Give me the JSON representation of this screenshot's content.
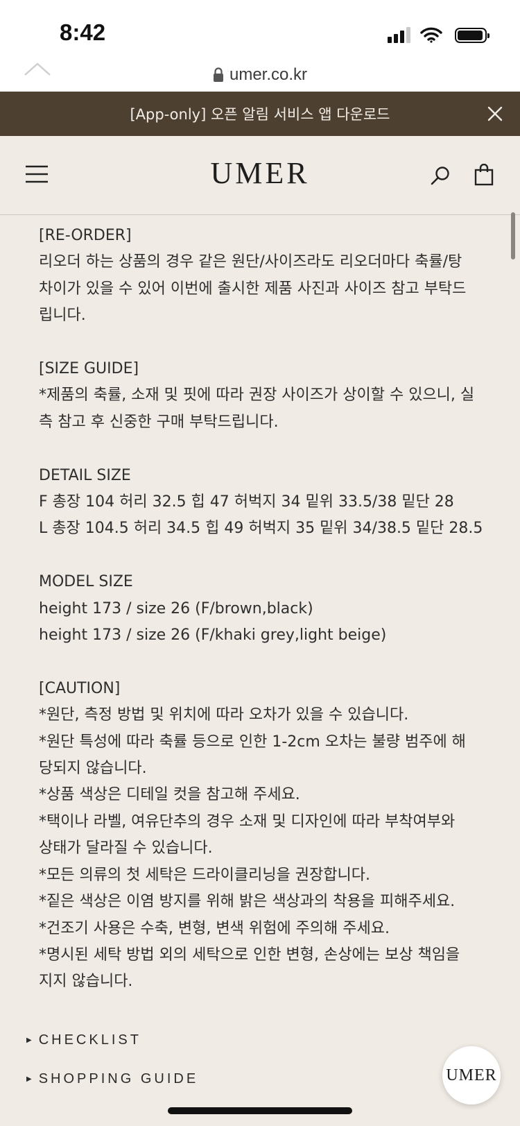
{
  "status_bar": {
    "time": "8:42"
  },
  "browser": {
    "url": "umer.co.kr"
  },
  "banner": {
    "text": "[App-only] 오픈 알림 서비스 앱 다운로드"
  },
  "header": {
    "logo": "UMER"
  },
  "content": {
    "reorder": {
      "title": "[RE-ORDER]",
      "lines": [
        "리오더 하는 상품의 경우 같은 원단/사이즈라도 리오더마다 축률/탕",
        "차이가 있을 수 있어 이번에 출시한 제품 사진과 사이즈 참고 부탁드",
        "립니다."
      ]
    },
    "size_guide": {
      "title": "[SIZE GUIDE]",
      "lines": [
        "*제품의 축률, 소재 및 핏에 따라 권장 사이즈가 상이할 수 있으니, 실",
        "측 참고 후 신중한 구매 부탁드립니다."
      ]
    },
    "detail_size": {
      "title": "DETAIL SIZE",
      "lines": [
        "F 총장 104 허리 32.5 힙 47 허벅지 34 밑위 33.5/38 밑단 28",
        "L 총장 104.5 허리 34.5 힙 49 허벅지 35 밑위 34/38.5 밑단 28.5"
      ]
    },
    "model_size": {
      "title": "MODEL SIZE",
      "lines": [
        "height 173 / size 26 (F/brown,black)",
        "height 173 / size 26 (F/khaki grey,light beige)"
      ]
    },
    "caution": {
      "title": "[CAUTION]",
      "lines": [
        "*원단, 측정 방법 및 위치에 따라 오차가 있을 수 있습니다.",
        "*원단 특성에 따라 축률 등으로 인한 1-2cm 오차는 불량 범주에 해",
        "당되지 않습니다.",
        "*상품 색상은 디테일 컷을 참고해 주세요.",
        "*택이나 라벨, 여유단추의 경우 소재 및 디자인에 따라 부착여부와",
        "상태가 달라질 수 있습니다.",
        "*모든 의류의 첫 세탁은 드라이클리닝을 권장합니다.",
        "*짙은 색상은 이염 방지를 위해 밝은 색상과의 착용을 피해주세요.",
        "*건조기 사용은 수축, 변형, 변색 위험에 주의해 주세요.",
        "*명시된 세탁 방법 외의 세탁으로 인한 변형, 손상에는 보상 책임을",
        "지지 않습니다."
      ]
    }
  },
  "guides": [
    {
      "label": "CHECKLIST"
    },
    {
      "label": "SHOPPING GUIDE"
    }
  ],
  "floating_button": {
    "label": "UMER"
  },
  "colors": {
    "banner_bg": "#4d4030",
    "page_bg": "#f0ebe4",
    "text": "#2e2e2e"
  },
  "icons": [
    "signal-icon",
    "wifi-icon",
    "battery-icon",
    "lock-icon",
    "close-icon",
    "menu-icon",
    "search-icon",
    "shopping-bag-icon",
    "chevron-up-icon"
  ]
}
